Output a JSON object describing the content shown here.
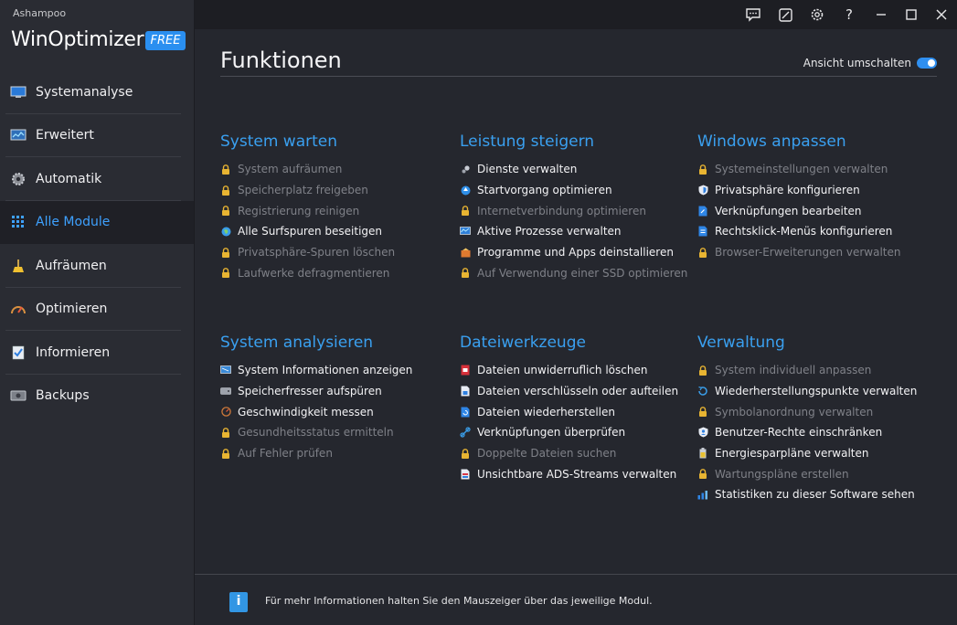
{
  "app": {
    "brand_small": "Ashampoo",
    "brand_main": "WinOptimizer",
    "brand_badge": "FREE"
  },
  "sidebar": {
    "items": [
      {
        "label": "Systemanalyse",
        "icon": "monitor-icon"
      },
      {
        "label": "Erweitert",
        "icon": "chart-icon"
      },
      {
        "label": "Automatik",
        "icon": "gear-icon"
      },
      {
        "label": "Alle Module",
        "icon": "grid-icon",
        "active": true
      },
      {
        "label": "Aufräumen",
        "icon": "broom-icon"
      },
      {
        "label": "Optimieren",
        "icon": "gauge-icon"
      },
      {
        "label": "Informieren",
        "icon": "checklist-icon"
      },
      {
        "label": "Backups",
        "icon": "backup-icon"
      }
    ]
  },
  "titlebar": {
    "buttons": [
      "feedback-icon",
      "skin-icon",
      "settings-icon",
      "help-icon",
      "minimize-icon",
      "maximize-icon",
      "close-icon"
    ]
  },
  "main": {
    "title": "Funktionen",
    "view_toggle_label": "Ansicht umschalten",
    "view_toggle_on": true,
    "sections": [
      {
        "title": "System warten",
        "items": [
          {
            "label": "System aufräumen",
            "locked": true
          },
          {
            "label": "Speicherplatz freigeben",
            "locked": true
          },
          {
            "label": "Registrierung reinigen",
            "locked": true
          },
          {
            "label": "Alle Surfspuren beseitigen",
            "locked": false,
            "icon": "globe-icon"
          },
          {
            "label": "Privatsphäre-Spuren löschen",
            "locked": true
          },
          {
            "label": "Laufwerke defragmentieren",
            "locked": true
          }
        ]
      },
      {
        "title": "Leistung steigern",
        "items": [
          {
            "label": "Dienste verwalten",
            "locked": false,
            "icon": "services-icon"
          },
          {
            "label": "Startvorgang optimieren",
            "locked": false,
            "icon": "startup-icon"
          },
          {
            "label": "Internetverbindung optimieren",
            "locked": true
          },
          {
            "label": "Aktive Prozesse verwalten",
            "locked": false,
            "icon": "process-icon"
          },
          {
            "label": "Programme und Apps deinstallieren",
            "locked": false,
            "icon": "uninstall-icon"
          },
          {
            "label": "Auf Verwendung einer SSD optimieren",
            "locked": true
          }
        ]
      },
      {
        "title": "Windows anpassen",
        "items": [
          {
            "label": "Systemeinstellungen verwalten",
            "locked": true
          },
          {
            "label": "Privatsphäre konfigurieren",
            "locked": false,
            "icon": "shield-icon"
          },
          {
            "label": "Verknüpfungen bearbeiten",
            "locked": false,
            "icon": "file-link-icon"
          },
          {
            "label": "Rechtsklick-Menüs konfigurieren",
            "locked": false,
            "icon": "menu-icon"
          },
          {
            "label": "Browser-Erweiterungen verwalten",
            "locked": true
          }
        ]
      },
      {
        "title": "System analysieren",
        "items": [
          {
            "label": "System Informationen anzeigen",
            "locked": false,
            "icon": "sysinfo-icon"
          },
          {
            "label": "Speicherfresser aufspüren",
            "locked": false,
            "icon": "disk-icon"
          },
          {
            "label": "Geschwindigkeit messen",
            "locked": false,
            "icon": "speed-icon"
          },
          {
            "label": "Gesundheitsstatus ermitteln",
            "locked": true
          },
          {
            "label": "Auf Fehler prüfen",
            "locked": true
          }
        ]
      },
      {
        "title": "Dateiwerkzeuge",
        "items": [
          {
            "label": "Dateien unwiderruflich löschen",
            "locked": false,
            "icon": "shredder-icon"
          },
          {
            "label": "Dateien verschlüsseln oder aufteilen",
            "locked": false,
            "icon": "encrypt-icon"
          },
          {
            "label": "Dateien wiederherstellen",
            "locked": false,
            "icon": "restore-file-icon"
          },
          {
            "label": "Verknüpfungen überprüfen",
            "locked": false,
            "icon": "link-icon"
          },
          {
            "label": "Doppelte Dateien suchen",
            "locked": true
          },
          {
            "label": "Unsichtbare ADS-Streams verwalten",
            "locked": false,
            "icon": "ads-icon"
          }
        ]
      },
      {
        "title": "Verwaltung",
        "items": [
          {
            "label": "System individuell anpassen",
            "locked": true
          },
          {
            "label": "Wiederherstellungspunkte verwalten",
            "locked": false,
            "icon": "restore-point-icon"
          },
          {
            "label": "Symbolanordnung verwalten",
            "locked": true
          },
          {
            "label": "Benutzer-Rechte einschränken",
            "locked": false,
            "icon": "user-shield-icon"
          },
          {
            "label": "Energiesparpläne verwalten",
            "locked": false,
            "icon": "battery-icon"
          },
          {
            "label": "Wartungspläne erstellen",
            "locked": true
          },
          {
            "label": "Statistiken zu dieser Software sehen",
            "locked": false,
            "icon": "stats-icon"
          }
        ]
      }
    ]
  },
  "footer": {
    "info_text": "Für mehr Informationen halten Sie den Mauszeiger über das jeweilige Modul."
  },
  "colors": {
    "accent": "#3aa0f0",
    "lock": "#e8b432",
    "badge": "#2a8ff0"
  }
}
